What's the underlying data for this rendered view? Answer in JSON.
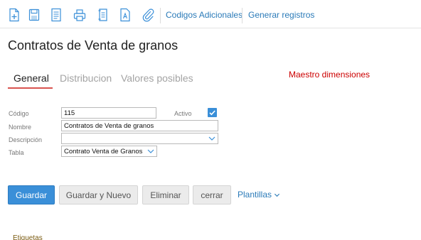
{
  "toolbar": {
    "icons": [
      "new-document-icon",
      "save-icon",
      "document-list-icon",
      "print-icon",
      "document-lines-icon",
      "text-document-icon",
      "attachment-icon"
    ],
    "links": [
      "Codigos Adicionales",
      "Generar registros"
    ]
  },
  "page": {
    "title": "Contratos de Venta de granos"
  },
  "tabs": [
    {
      "label": "General",
      "active": true
    },
    {
      "label": "Distribucion",
      "active": false
    },
    {
      "label": "Valores posibles",
      "active": false
    }
  ],
  "maestro_label": "Maestro dimensiones",
  "form": {
    "codigo": {
      "label": "Código",
      "value": "115"
    },
    "activo": {
      "label": "Activo",
      "checked": true
    },
    "nombre": {
      "label": "Nombre",
      "value": "Contratos de Venta de granos"
    },
    "descripcion": {
      "label": "Descripción",
      "value": ""
    },
    "tabla": {
      "label": "Tabla",
      "value": "Contrato Venta de Granos"
    }
  },
  "actions": {
    "guardar": "Guardar",
    "guardar_nuevo": "Guardar y Nuevo",
    "eliminar": "Eliminar",
    "cerrar": "cerrar",
    "plantillas": "Plantillas"
  },
  "etiquetas_label": "Etiquetas",
  "colors": {
    "accent": "#3a8fd8",
    "link": "#2a7ab8",
    "tab_underline": "#d9534f",
    "maestro": "#cc0000"
  }
}
